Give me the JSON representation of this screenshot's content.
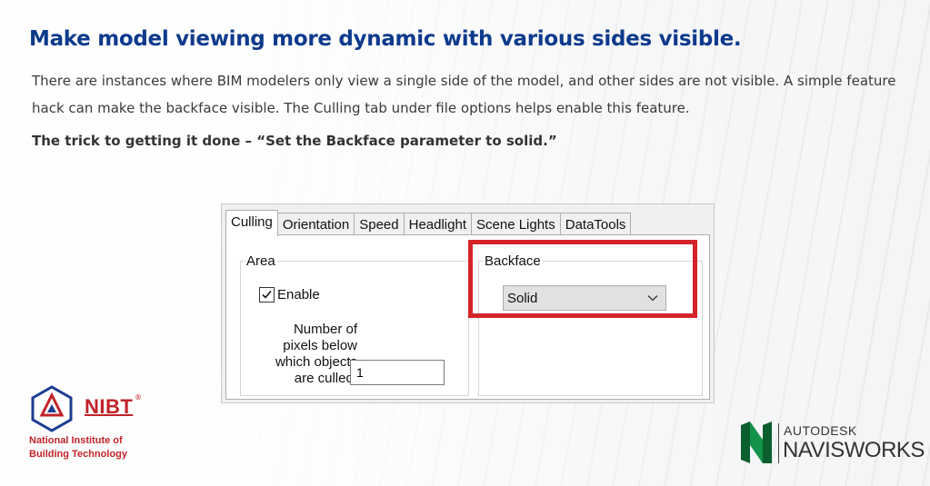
{
  "headline": "Make model viewing more dynamic with various sides visible.",
  "paragraph": "There are instances where BIM modelers only view a single side of the model, and other sides are not visible. A simple feature hack can make the backface visible. The Culling tab under file options helps enable this feature.",
  "trick": "The trick to getting it done – “Set the Backface parameter to solid.”",
  "dialog": {
    "tabs": [
      "Culling",
      "Orientation",
      "Speed",
      "Headlight",
      "Scene Lights",
      "DataTools"
    ],
    "active_tab": "Culling",
    "area": {
      "legend": "Area",
      "enable_label": "Enable",
      "enable_checked": true,
      "pixels_label": "Number of pixels below which objects are culled:",
      "pixels_value": "1"
    },
    "backface": {
      "legend": "Backface",
      "selected": "Solid"
    }
  },
  "colors": {
    "headline": "#0d3a8c",
    "highlight": "#d3242a",
    "nibt": "#c2232a",
    "navisworks_green": "#0f7a3a"
  },
  "logos": {
    "nibt_name": "NIBT",
    "nibt_reg": "®",
    "nibt_line1": "National Institute of",
    "nibt_line2": "Building Technology",
    "autodesk": "AUTODESK",
    "navisworks": "NAVISWORKS"
  }
}
